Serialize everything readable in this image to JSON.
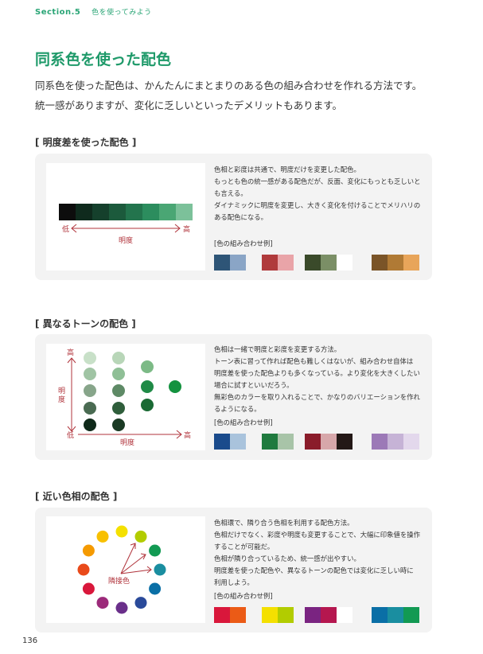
{
  "header": {
    "section": "Section.5",
    "subtitle": "色を使ってみよう"
  },
  "title": "同系色を使った配色",
  "lead": [
    "同系色を使った配色は、かんたんにまとまりのある色の組み合わせを作れる方法です。",
    "統一感がありますが、変化に乏しいといったデメリットもあります。"
  ],
  "sections": [
    {
      "heading": "[ 明度差を使った配色 ]",
      "desc": [
        "色相と彩度は共通で、明度だけを変更した配色。",
        "もっとも色の統一感がある配色だが、反面、変化にもっとも乏しいと",
        "も言える。",
        "ダイナミックに明度を変更し、大きく変化を付けることでメリハリの",
        "ある配色になる。"
      ],
      "palette_label": "[色の組み合わせ例]",
      "diagram": {
        "low": "低",
        "high": "高",
        "axis": "明度",
        "gradient": [
          "#0d0d0d",
          "#0f2a1d",
          "#15402c",
          "#1c5a3c",
          "#23744d",
          "#2c8d5e",
          "#4aa674",
          "#7cc19a"
        ]
      },
      "palettes": [
        [
          "#2e5577",
          "#8aa5c6"
        ],
        [
          "#b03a3c",
          "#e9a4a8"
        ],
        [
          "#3a4a2a",
          "#7b8f66",
          "#ffffff"
        ],
        [
          "#7a5428",
          "#b07a35",
          "#e8a55a"
        ]
      ]
    },
    {
      "heading": "[ 異なるトーンの配色 ]",
      "desc": [
        "色相は一緒で明度と彩度を変更する方法。",
        "トーン表に習って作れば配色も難しくはないが、組み合わせ自体は",
        "明度差を使った配色よりも多くなっている。より変化を大きくしたい",
        "場合に試すといいだろう。",
        "無彩色のカラーを取り入れることで、かなりのバリエーションを作れ",
        "るようになる。"
      ],
      "palette_label": "[色の組み合わせ例]",
      "diagram": {
        "high": "高",
        "low": "低",
        "high2": "高",
        "y_axis": "明度",
        "x_axis": "明度"
      },
      "palettes": [
        [
          "#1a4b8c",
          "#a9c3dc"
        ],
        [
          "#1f7a3e",
          "#a8c4a8"
        ],
        [
          "#8a1c2a",
          "#d7a7aa",
          "#231816"
        ],
        [
          "#9c79b7",
          "#c6b3d6",
          "#e3d8ec"
        ]
      ]
    },
    {
      "heading": "[ 近い色相の配色 ]",
      "desc": [
        "色相環で、隣り合う色相を利用する配色方法。",
        "色相だけでなく、彩度や明度も変更することで、大幅に印象値を操作",
        "することが可能だ。",
        "色相が隣り合っているため、統一感が出やすい。",
        "明度差を使った配色や、異なるトーンの配色では変化に乏しい時に",
        "利用しよう。"
      ],
      "palette_label": "[色の組み合わせ例]",
      "diagram": {
        "center": "隣接色"
      },
      "palettes": [
        [
          "#d9173b",
          "#eb5b16"
        ],
        [
          "#f4e000",
          "#b2cc00"
        ],
        [
          "#7a2481",
          "#b5174f",
          "#ffffff"
        ],
        [
          "#0a6fa6",
          "#1a8ea0",
          "#129a53"
        ]
      ]
    }
  ],
  "page_number": "136"
}
